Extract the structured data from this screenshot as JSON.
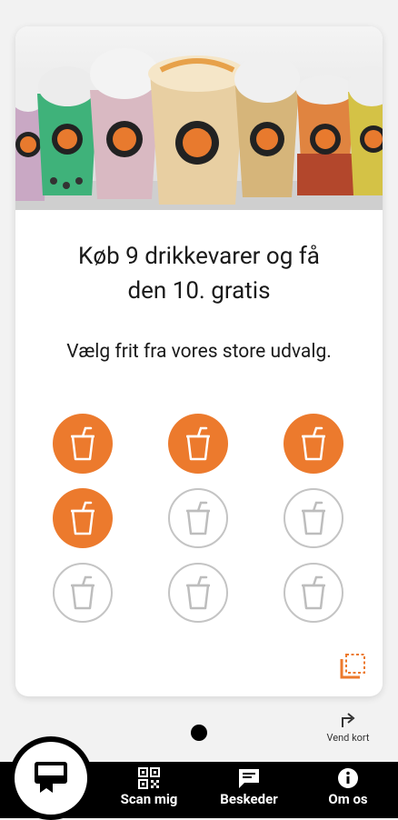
{
  "card": {
    "title_line1": "Køb 9 drikkevarer og få",
    "title_line2": "den 10. gratis",
    "subtitle": "Vælg frit fra vores store udvalg."
  },
  "stamps": {
    "total": 9,
    "collected": 4,
    "filled_color": "#ec7a2d",
    "empty_color": "#c4c4c4",
    "icon": "drink-cup-icon"
  },
  "pager": {
    "active_dot": 1
  },
  "flip": {
    "label": "Vend kort",
    "icon": "flip-arrow-icon"
  },
  "nav": {
    "home_icon": "card-icon",
    "scan_label": "Scan mig",
    "messages_label": "Beskeder",
    "about_label": "Om os"
  },
  "colors": {
    "accent": "#ec7a2d",
    "bar": "#000000",
    "background": "#f2f2f2"
  }
}
